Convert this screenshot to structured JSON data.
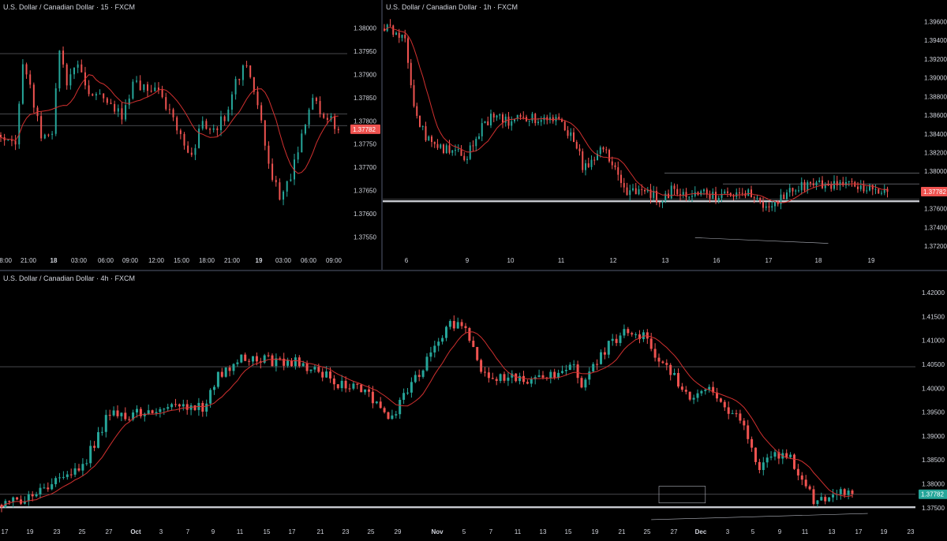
{
  "theme": {
    "background": "#000000",
    "up": "#26a69a",
    "down": "#ef5350",
    "ma": "#d1302f",
    "level": "#b2b5be",
    "text": "#d1d4dc"
  },
  "chart_data": [
    {
      "id": "m15",
      "type": "candlestick",
      "title": "U.S. Dollar / Canadian Dollar · 15 · FXCM",
      "x_tick_labels": [
        "18:00",
        "21:00",
        "18",
        "03:00",
        "06:00",
        "09:00",
        "12:00",
        "15:00",
        "18:00",
        "21:00",
        "19",
        "03:00",
        "06:00",
        "09:00"
      ],
      "y_tick_labels": [
        "1.38000",
        "1.37950",
        "1.37900",
        "1.37850",
        "1.37800",
        "1.37750",
        "1.37700",
        "1.37650",
        "1.37600",
        "1.37550"
      ],
      "ylim": [
        1.3752,
        1.3803
      ],
      "last_price": {
        "label": "1.37782",
        "value": 1.37782,
        "color": "#ef5350"
      },
      "horizontal_levels": [
        1.37945,
        1.37815,
        1.3779
      ],
      "has_moving_average": true,
      "path": [
        [
          0,
          1.3777
        ],
        [
          4,
          1.3776
        ],
        [
          6,
          1.3793
        ],
        [
          8,
          1.3787
        ],
        [
          11,
          1.3777
        ],
        [
          14,
          1.3778
        ],
        [
          16,
          1.3795
        ],
        [
          18,
          1.3788
        ],
        [
          21,
          1.3793
        ],
        [
          24,
          1.3786
        ],
        [
          27,
          1.3787
        ],
        [
          30,
          1.3784
        ],
        [
          33,
          1.3781
        ],
        [
          36,
          1.3788
        ],
        [
          40,
          1.3787
        ],
        [
          43,
          1.3786
        ],
        [
          47,
          1.3781
        ],
        [
          50,
          1.3774
        ],
        [
          52,
          1.3772
        ],
        [
          55,
          1.378
        ],
        [
          58,
          1.3778
        ],
        [
          61,
          1.3781
        ],
        [
          64,
          1.3788
        ],
        [
          67,
          1.3793
        ],
        [
          70,
          1.3784
        ],
        [
          73,
          1.377
        ],
        [
          76,
          1.3764
        ],
        [
          79,
          1.3768
        ],
        [
          82,
          1.3777
        ],
        [
          85,
          1.3784
        ],
        [
          89,
          1.3781
        ],
        [
          92,
          1.3778
        ]
      ]
    },
    {
      "id": "h1",
      "type": "candlestick",
      "title": "U.S. Dollar / Canadian Dollar · 1h · FXCM",
      "x_tick_labels": [
        "6",
        "9",
        "10",
        "11",
        "12",
        "13",
        "16",
        "17",
        "18",
        "19"
      ],
      "y_tick_labels": [
        "1.39600",
        "1.39400",
        "1.39200",
        "1.39000",
        "1.38800",
        "1.38600",
        "1.38400",
        "1.38200",
        "1.38000",
        "1.37800",
        "1.37600",
        "1.37400",
        "1.37200"
      ],
      "ylim": [
        1.3715,
        1.3968
      ],
      "last_price": {
        "label": "1.37782",
        "value": 1.37782,
        "color": "#ef5350"
      },
      "horizontal_levels": [
        1.3798,
        1.37865,
        1.377
      ],
      "support_level": 1.3768,
      "trendline": {
        "from": [
          105,
          1.3729
        ],
        "to": [
          150,
          1.3723
        ]
      },
      "has_moving_average": true,
      "path": [
        [
          0,
          1.3952
        ],
        [
          4,
          1.395
        ],
        [
          7,
          1.3942
        ],
        [
          9,
          1.389
        ],
        [
          11,
          1.3855
        ],
        [
          14,
          1.3838
        ],
        [
          17,
          1.3826
        ],
        [
          22,
          1.3823
        ],
        [
          25,
          1.3818
        ],
        [
          27,
          1.3812
        ],
        [
          30,
          1.3829
        ],
        [
          33,
          1.385
        ],
        [
          36,
          1.3857
        ],
        [
          40,
          1.3855
        ],
        [
          43,
          1.3851
        ],
        [
          46,
          1.3857
        ],
        [
          49,
          1.3857
        ],
        [
          53,
          1.3853
        ],
        [
          56,
          1.3858
        ],
        [
          59,
          1.3855
        ],
        [
          62,
          1.3843
        ],
        [
          65,
          1.3826
        ],
        [
          67,
          1.3806
        ],
        [
          70,
          1.3811
        ],
        [
          73,
          1.382
        ],
        [
          76,
          1.3816
        ],
        [
          78,
          1.3802
        ],
        [
          80,
          1.3786
        ],
        [
          83,
          1.3776
        ],
        [
          86,
          1.378
        ],
        [
          89,
          1.3778
        ],
        [
          92,
          1.3772
        ],
        [
          95,
          1.3772
        ],
        [
          97,
          1.378
        ],
        [
          100,
          1.3776
        ],
        [
          103,
          1.3775
        ],
        [
          106,
          1.3774
        ],
        [
          109,
          1.3776
        ],
        [
          112,
          1.3774
        ],
        [
          115,
          1.3777
        ],
        [
          118,
          1.3778
        ],
        [
          121,
          1.3776
        ],
        [
          124,
          1.3776
        ],
        [
          127,
          1.3763
        ],
        [
          130,
          1.3766
        ],
        [
          133,
          1.377
        ],
        [
          136,
          1.3775
        ],
        [
          139,
          1.3782
        ],
        [
          142,
          1.3785
        ],
        [
          145,
          1.3789
        ],
        [
          148,
          1.3785
        ],
        [
          152,
          1.3787
        ],
        [
          155,
          1.3784
        ],
        [
          158,
          1.3785
        ],
        [
          161,
          1.3783
        ],
        [
          164,
          1.3786
        ],
        [
          167,
          1.3781
        ],
        [
          170,
          1.3778
        ]
      ]
    },
    {
      "id": "h4",
      "type": "candlestick",
      "title": "U.S. Dollar / Canadian Dollar · 4h · FXCM",
      "x_tick_labels": [
        "17",
        "19",
        "23",
        "25",
        "27",
        "Oct",
        "3",
        "7",
        "9",
        "11",
        "15",
        "17",
        "21",
        "23",
        "25",
        "29",
        "Nov",
        "5",
        "7",
        "11",
        "13",
        "15",
        "19",
        "21",
        "25",
        "27",
        "Dec",
        "3",
        "5",
        "9",
        "11",
        "13",
        "17",
        "19",
        "23"
      ],
      "y_tick_labels": [
        "1.42000",
        "1.41500",
        "1.41000",
        "1.40500",
        "1.40000",
        "1.39500",
        "1.39000",
        "1.38500",
        "1.38000",
        "1.37500"
      ],
      "ylim": [
        1.372,
        1.4215
      ],
      "last_price": {
        "label": "1.37782",
        "value": 1.37782,
        "color": "#26a69a"
      },
      "horizontal_levels": [
        1.4045,
        1.3778
      ],
      "support_level": 1.3751,
      "range_box": {
        "x0": 170,
        "x1": 182,
        "y0": 1.3795,
        "y1": 1.376
      },
      "trendline": {
        "from": [
          168,
          1.3725
        ],
        "to": [
          224,
          1.3738
        ]
      },
      "has_moving_average": true,
      "path": [
        [
          0,
          1.3754
        ],
        [
          4,
          1.3764
        ],
        [
          8,
          1.3782
        ],
        [
          12,
          1.3793
        ],
        [
          16,
          1.381
        ],
        [
          20,
          1.3825
        ],
        [
          24,
          1.3883
        ],
        [
          28,
          1.395
        ],
        [
          32,
          1.3942
        ],
        [
          36,
          1.395
        ],
        [
          40,
          1.3957
        ],
        [
          44,
          1.3958
        ],
        [
          48,
          1.3961
        ],
        [
          52,
          1.3962
        ],
        [
          56,
          1.4025
        ],
        [
          60,
          1.4052
        ],
        [
          64,
          1.4067
        ],
        [
          68,
          1.406
        ],
        [
          72,
          1.4055
        ],
        [
          76,
          1.4054
        ],
        [
          80,
          1.404
        ],
        [
          84,
          1.4025
        ],
        [
          88,
          1.4005
        ],
        [
          92,
          1.4005
        ],
        [
          96,
          1.3978
        ],
        [
          100,
          1.3932
        ],
        [
          104,
          1.398
        ],
        [
          108,
          1.403
        ],
        [
          112,
          1.4085
        ],
        [
          116,
          1.4135
        ],
        [
          120,
          1.4125
        ],
        [
          124,
          1.404
        ],
        [
          128,
          1.4022
        ],
        [
          132,
          1.4023
        ],
        [
          136,
          1.4008
        ],
        [
          140,
          1.4022
        ],
        [
          144,
          1.403
        ],
        [
          148,
          1.4052
        ],
        [
          150,
          1.3998
        ],
        [
          154,
          1.406
        ],
        [
          158,
          1.41
        ],
        [
          162,
          1.4118
        ],
        [
          166,
          1.4108
        ],
        [
          170,
          1.4055
        ],
        [
          174,
          1.4023
        ],
        [
          178,
          1.3975
        ],
        [
          182,
          1.4
        ],
        [
          186,
          1.397
        ],
        [
          190,
          1.3945
        ],
        [
          193,
          1.39
        ],
        [
          196,
          1.3831
        ],
        [
          200,
          1.3862
        ],
        [
          204,
          1.3855
        ],
        [
          207,
          1.38
        ],
        [
          210,
          1.3768
        ],
        [
          214,
          1.3768
        ],
        [
          217,
          1.378
        ],
        [
          220,
          1.3779
        ]
      ]
    }
  ]
}
